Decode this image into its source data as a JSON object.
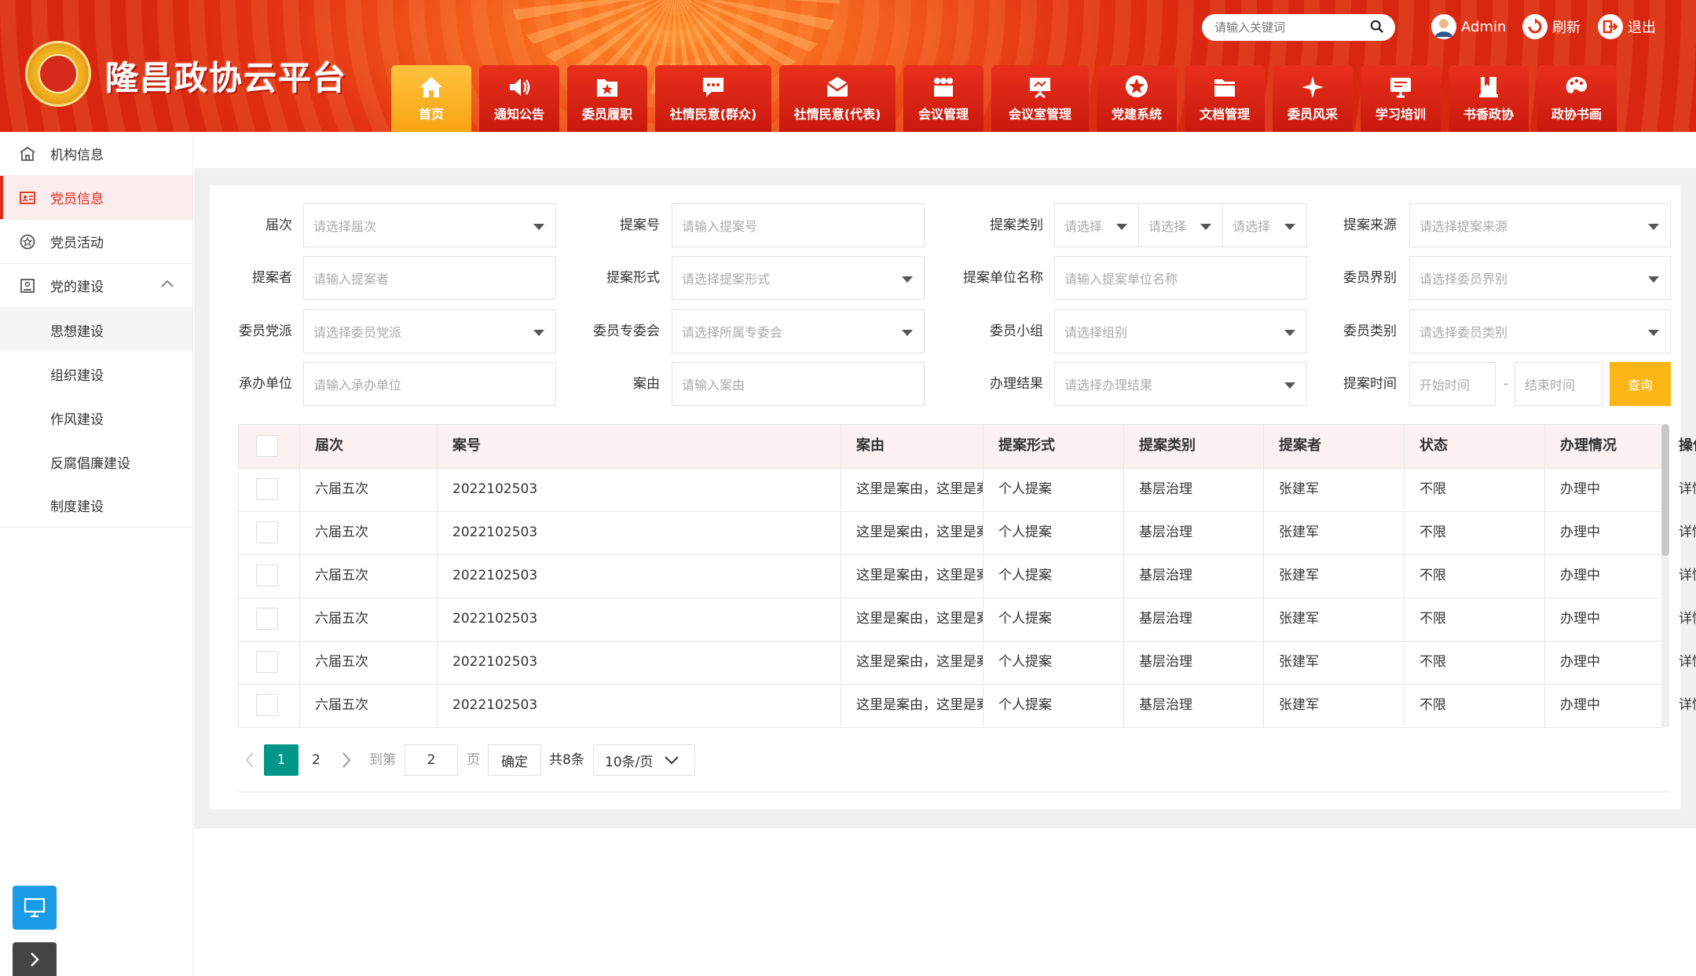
{
  "app": {
    "title": "隆昌政协云平台"
  },
  "topbar": {
    "search_placeholder": "请输入关键词",
    "user": "Admin",
    "refresh": "刷新",
    "logout": "退出"
  },
  "nav": [
    {
      "label": "首页",
      "icon": "home-icon",
      "active": true
    },
    {
      "label": "通知公告",
      "icon": "speaker-icon"
    },
    {
      "label": "委员履职",
      "icon": "folder-star-icon"
    },
    {
      "label": "社情民意(群众)",
      "icon": "chat-icon"
    },
    {
      "label": "社情民意(代表)",
      "icon": "mail-icon"
    },
    {
      "label": "会议管理",
      "icon": "people-icon"
    },
    {
      "label": "会议室管理",
      "icon": "presentation-icon"
    },
    {
      "label": "党建系统",
      "icon": "star-icon"
    },
    {
      "label": "文档管理",
      "icon": "folder-icon"
    },
    {
      "label": "委员风采",
      "icon": "sparkle-icon"
    },
    {
      "label": "学习培训",
      "icon": "board-icon"
    },
    {
      "label": "书香政协",
      "icon": "book-icon"
    },
    {
      "label": "政协书画",
      "icon": "palette-icon"
    }
  ],
  "sidebar": {
    "items": [
      {
        "label": "机构信息",
        "icon": "building-icon"
      },
      {
        "label": "党员信息",
        "icon": "id-card-icon",
        "active": true
      },
      {
        "label": "党员活动",
        "icon": "badge-icon"
      },
      {
        "label": "党的建设",
        "icon": "party-icon",
        "expanded": true
      }
    ],
    "subitems": [
      {
        "label": "思想建设",
        "active": true
      },
      {
        "label": "组织建设"
      },
      {
        "label": "作风建设"
      },
      {
        "label": "反腐倡廉建设"
      },
      {
        "label": "制度建设"
      }
    ]
  },
  "filters": {
    "session": {
      "label": "届次",
      "placeholder": "请选择届次"
    },
    "proposal_no": {
      "label": "提案号",
      "placeholder": "请输入提案号"
    },
    "category": {
      "label": "提案类别",
      "p1": "请选择",
      "p2": "请选择",
      "p3": "请选择"
    },
    "source": {
      "label": "提案来源",
      "placeholder": "请选择提案来源"
    },
    "proposer": {
      "label": "提案者",
      "placeholder": "请输入提案者"
    },
    "form": {
      "label": "提案形式",
      "placeholder": "请选择提案形式"
    },
    "unit_name": {
      "label": "提案单位名称",
      "placeholder": "请输入提案单位名称"
    },
    "sector": {
      "label": "委员界别",
      "placeholder": "请选择委员界别"
    },
    "party": {
      "label": "委员党派",
      "placeholder": "请选择委员党派"
    },
    "committee": {
      "label": "委员专委会",
      "placeholder": "请选择所属专委会"
    },
    "group": {
      "label": "委员小组",
      "placeholder": "请选择组别"
    },
    "member_type": {
      "label": "委员类别",
      "placeholder": "请选择委员类别"
    },
    "handler": {
      "label": "承办单位",
      "placeholder": "请输入承办单位"
    },
    "subject": {
      "label": "案由",
      "placeholder": "请输入案由"
    },
    "result": {
      "label": "办理结果",
      "placeholder": "请选择办理结果"
    },
    "time": {
      "label": "提案时间",
      "start": "开始时间",
      "sep": "-",
      "end": "结束时间"
    },
    "query": "查询"
  },
  "table": {
    "headers": [
      "届次",
      "案号",
      "案由",
      "提案形式",
      "提案类别",
      "提案者",
      "状态",
      "办理情况",
      "操作"
    ],
    "rows": [
      [
        "六届五次",
        "2022102503",
        "这里是案由，这里是案由，这里是案由。",
        "个人提案",
        "基层治理",
        "张建军",
        "不限",
        "办理中",
        "详情"
      ],
      [
        "六届五次",
        "2022102503",
        "这里是案由，这里是案由，这里是案由。",
        "个人提案",
        "基层治理",
        "张建军",
        "不限",
        "办理中",
        "详情"
      ],
      [
        "六届五次",
        "2022102503",
        "这里是案由，这里是案由，这里是案由。",
        "个人提案",
        "基层治理",
        "张建军",
        "不限",
        "办理中",
        "详情"
      ],
      [
        "六届五次",
        "2022102503",
        "这里是案由，这里是案由，这里是案由。",
        "个人提案",
        "基层治理",
        "张建军",
        "不限",
        "办理中",
        "详情"
      ],
      [
        "六届五次",
        "2022102503",
        "这里是案由，这里是案由，这里是案由。",
        "个人提案",
        "基层治理",
        "张建军",
        "不限",
        "办理中",
        "详情"
      ],
      [
        "六届五次",
        "2022102503",
        "这里是案由，这里是案由，这里是案由。",
        "个人提案",
        "基层治理",
        "张建军",
        "不限",
        "办理中",
        "详情"
      ]
    ]
  },
  "pager": {
    "current": "1",
    "page2": "2",
    "goto": "到第",
    "goto_value": "2",
    "page_unit": "页",
    "confirm": "确定",
    "total": "共8条",
    "per_page": "10条/页"
  },
  "colors": {
    "primary": "#e02a1c",
    "accent": "#fbb515",
    "pager": "#009688"
  }
}
